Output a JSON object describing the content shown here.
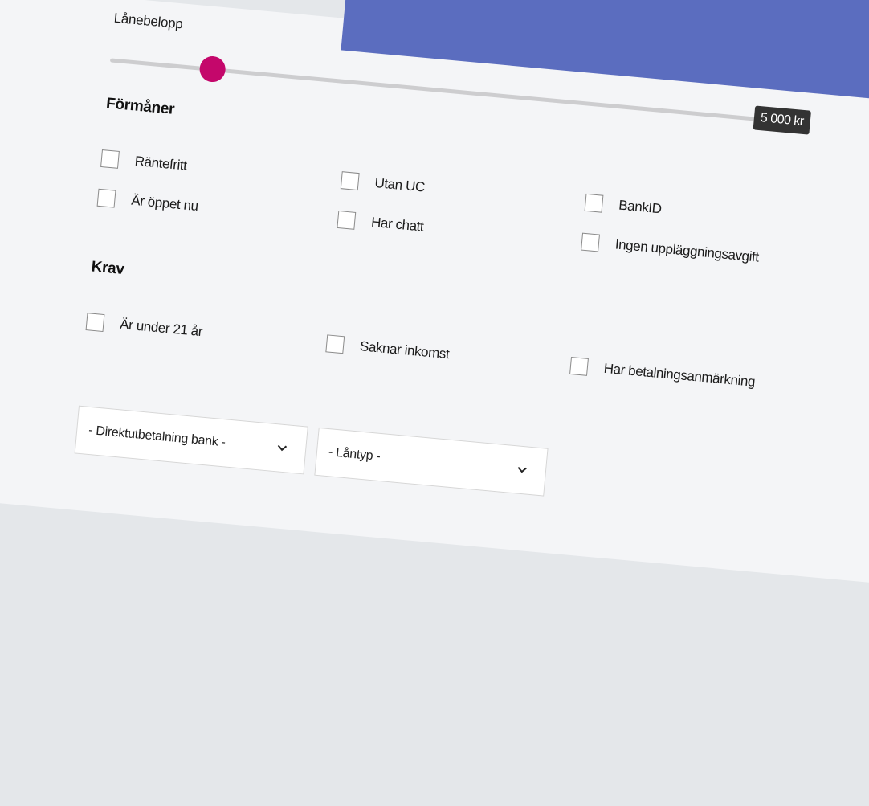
{
  "slider": {
    "label": "Lånebelopp",
    "value": "5 000 kr",
    "fraction": 0.14
  },
  "benefits": {
    "heading": "Förmåner",
    "options": [
      "Räntefritt",
      "Är öppet nu",
      "Utan UC",
      "Har chatt",
      "BankID",
      "Ingen uppläggningsavgift"
    ]
  },
  "requirements": {
    "heading": "Krav",
    "options": [
      "Är under 21 år",
      "Saknar inkomst",
      "Har betalningsanmärkning"
    ]
  },
  "filters": {
    "direct_payment": "- Direktutbetalning bank -",
    "loan_type": "- Låntyp -"
  },
  "colors": {
    "accent": "#c4076b",
    "banner": "#5b6dbf",
    "background": "#f4f5f7"
  }
}
